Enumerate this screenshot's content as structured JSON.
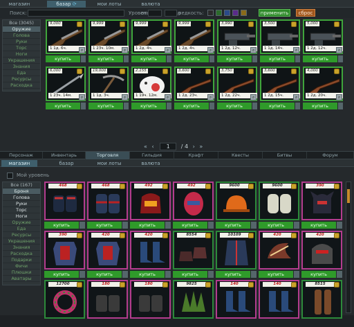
{
  "top": {
    "tabs": [
      "магазин",
      "базар",
      "мои лоты",
      "валюта"
    ],
    "active_tab": 1,
    "filter": {
      "search_label": "Поиск:",
      "search_value": "",
      "level_label": "Уровень:",
      "from_label": "от",
      "to_label": "до",
      "rarity_label": "редкость:",
      "rarity_colors": [
        "#2b2b2b",
        "#2b6b2b",
        "#2b4a8a",
        "#5a2b8a",
        "#8a6b1a"
      ],
      "apply_label": "применить",
      "reset_label": "сброс"
    },
    "categories": [
      "Все (3045)",
      "Оружие",
      "Голова",
      "Руки",
      "Торс",
      "Ноги",
      "Украшения",
      "Знания",
      "Еда",
      "Ресурсы",
      "Расходка"
    ],
    "active_category": 1,
    "items": [
      {
        "price": "9,000",
        "stats": "1        1д. 6ч.",
        "icon": "rifle-icon"
      },
      {
        "price": "9,999",
        "stats": "1      23ч. 10м.",
        "icon": "rifle-icon"
      },
      {
        "price": "9,999",
        "stats": "1        2д. 4ч.",
        "icon": "rifle-icon"
      },
      {
        "price": "9,999",
        "stats": "1        2д. 4ч.",
        "icon": "rifle-icon"
      },
      {
        "price": "3,990",
        "stats": "1      2д. 12ч.",
        "icon": "machine-gun-icon"
      },
      {
        "price": "3,500",
        "stats": "1      1д. 14ч.",
        "icon": "machine-gun-icon"
      },
      {
        "price": "5,000",
        "stats": "1      2д. 12ч.",
        "icon": "machine-gun-icon"
      },
      {
        "price": "6,000",
        "stats": "1    23ч. 14м.",
        "icon": "spear-icon"
      },
      {
        "price": "19,000",
        "stats": "1        1д. 3ч.",
        "icon": "pickaxe-icon"
      },
      {
        "price": "2,155",
        "stats": "1      19ч. 12м.",
        "icon": "pig-mask-icon"
      },
      {
        "price": "3,600",
        "stats": "1      2д. 23ч.",
        "icon": "shotgun-icon"
      },
      {
        "price": "3,750",
        "stats": "1      2д. 22ч.",
        "icon": "shotgun-icon"
      },
      {
        "price": "3,600",
        "stats": "1      2д. 15ч.",
        "icon": "shotgun-icon"
      },
      {
        "price": "4,000",
        "stats": "1      2д. 20ч.",
        "icon": "shotgun-icon"
      }
    ],
    "buy_label": "купить",
    "pager": {
      "current": "1",
      "total": "/ 4"
    }
  },
  "nav": [
    "Персонаж",
    "Инвентарь",
    "Торговля",
    "Гильдия",
    "Крафт",
    "Квесты",
    "Битвы",
    "Форум"
  ],
  "active_nav": 2,
  "bottom": {
    "tabs": [
      "магазин",
      "базар",
      "мои лоты",
      "валюта"
    ],
    "active_tab": 0,
    "my_level_label": "Мой уровень",
    "categories": [
      "Все (167)",
      "Броня",
      "Голова",
      "Руки",
      "Торс",
      "Ноги",
      "Оружие",
      "Еда",
      "Ресурсы",
      "Украшения",
      "Знания",
      "Расходка",
      "Подарки",
      "Фичи",
      "Плюшки",
      "Аватары"
    ],
    "active_category": 1,
    "items": [
      {
        "price": "468",
        "red": true,
        "icon": "spiked-gloves-icon"
      },
      {
        "price": "468",
        "red": true,
        "icon": "gloves-icon"
      },
      {
        "price": "492",
        "red": true,
        "icon": "helmet-icon"
      },
      {
        "price": "492",
        "red": true,
        "icon": "mask-helmet-icon"
      },
      {
        "price": "9600",
        "red": false,
        "icon": "hard-hat-icon"
      },
      {
        "price": "9600",
        "red": false,
        "icon": "mittens-icon"
      },
      {
        "price": "390",
        "red": true,
        "icon": "demon-helmet-icon"
      },
      {
        "price": "390",
        "red": true,
        "icon": "armor-icon"
      },
      {
        "price": "420",
        "red": true,
        "icon": "armor-icon"
      },
      {
        "price": "420",
        "red": true,
        "icon": "boots-icon"
      },
      {
        "price": "8554",
        "red": false,
        "icon": "shoes-icon"
      },
      {
        "price": "10109",
        "red": false,
        "icon": "coat-icon"
      },
      {
        "price": "420",
        "red": true,
        "icon": "claw-icon"
      },
      {
        "price": "420",
        "red": true,
        "icon": "warrior-helmet-icon"
      },
      {
        "price": "12700",
        "red": false,
        "icon": "wreath-icon"
      },
      {
        "price": "180",
        "red": true,
        "icon": "gauntlet-icon"
      },
      {
        "price": "180",
        "red": true,
        "icon": "gauntlet-icon"
      },
      {
        "price": "9825",
        "red": false,
        "icon": "moss-icon"
      },
      {
        "price": "140",
        "red": true,
        "icon": "boots-icon"
      },
      {
        "price": "140",
        "red": true,
        "icon": "boots-icon"
      },
      {
        "price": "8515",
        "red": false,
        "icon": "leg-guard-icon"
      }
    ],
    "buy_label": "купить"
  }
}
